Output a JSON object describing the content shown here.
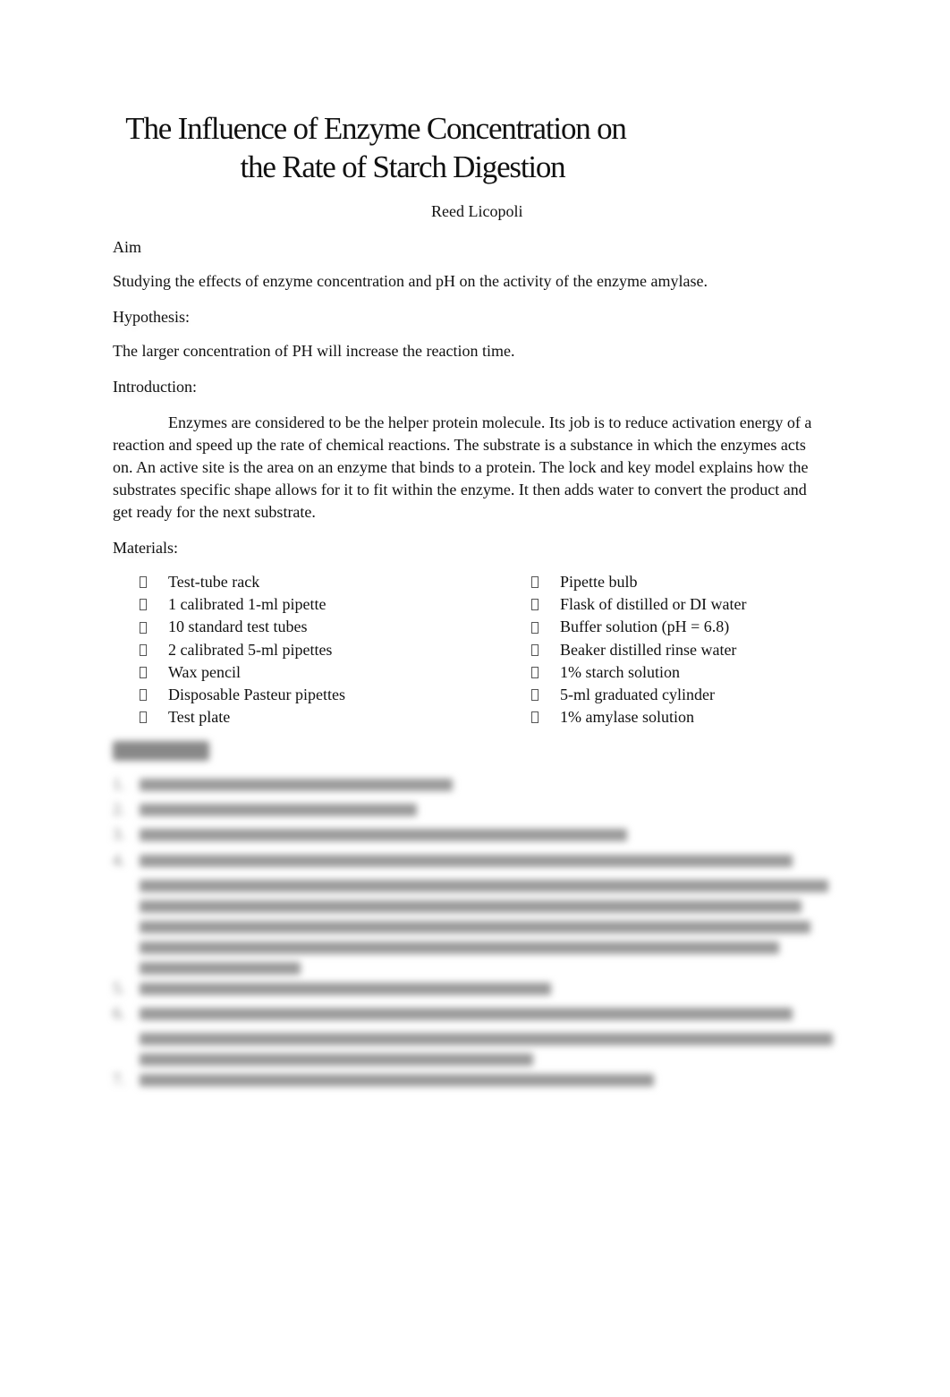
{
  "document": {
    "title_line1": "The Influence of Enzyme Concentration on",
    "title_line2": "the Rate of Starch Digestion",
    "author": "Reed Licopoli",
    "sections": {
      "aim_heading": "Aim",
      "aim_text": "Studying the effects of enzyme concentration and pH on the activity of the enzyme amylase.",
      "hypothesis_heading": "Hypothesis:",
      "hypothesis_text": "The larger concentration of PH will increase the reaction time.",
      "introduction_heading": "Introduction:",
      "introduction_text": "Enzymes are considered to be the helper protein molecule. Its job is to reduce activation energy of a reaction and speed up the rate of chemical reactions. The substrate is a substance in which the enzymes acts on. An active site is the area on an enzyme that binds to a protein. The lock and key model explains how the substrates specific shape allows for it to fit within the enzyme. It then adds water to convert the product and get ready for the next substrate.",
      "materials_heading": "Materials:"
    },
    "materials_left": [
      "Test-tube rack",
      "1 calibrated 1-ml pipette",
      "10 standard test tubes",
      "2 calibrated 5-ml pipettes",
      "Wax pencil",
      "Disposable Pasteur pipettes",
      "Test plate"
    ],
    "materials_right": [
      "Pipette bulb",
      "Flask of distilled or DI water",
      "Buffer solution (pH = 6.8)",
      "Beaker distilled rinse water",
      "1% starch solution",
      "5-ml graduated cylinder",
      "1% amylase solution"
    ],
    "bullet_icon": "missing-glyph-box",
    "obscured_section": {
      "note": "blurred / unreadable",
      "numbered_items": [
        "1.",
        "2.",
        "3.",
        "4.",
        "5.",
        "6.",
        "7."
      ]
    }
  }
}
